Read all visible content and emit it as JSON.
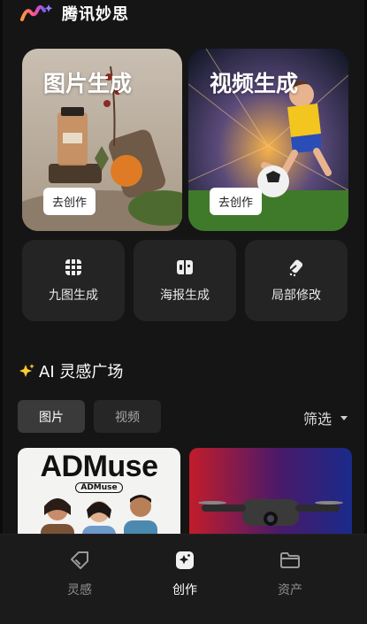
{
  "header": {
    "brand": "腾讯妙思",
    "logo_icon": "mio-brush-logo-icon"
  },
  "hero_cards": [
    {
      "title": "图片生成",
      "button": "去创作"
    },
    {
      "title": "视频生成",
      "button": "去创作"
    }
  ],
  "tools": [
    {
      "label": "九图生成",
      "icon": "grid-icon"
    },
    {
      "label": "海报生成",
      "icon": "poster-icon"
    },
    {
      "label": "局部修改",
      "icon": "eraser-icon"
    }
  ],
  "inspiration": {
    "title": "AI 灵感广场",
    "tabs": [
      "图片",
      "视频"
    ],
    "active_tab": "图片",
    "filter_label": "筛选"
  },
  "gallery": [
    {
      "headline": "ADMuse",
      "badge": "ADMuse"
    },
    {
      "subject": "drone"
    }
  ],
  "bottom_nav": [
    {
      "label": "灵感",
      "icon": "tag-icon",
      "active": false
    },
    {
      "label": "创作",
      "icon": "sparkle-square-icon",
      "active": true
    },
    {
      "label": "资产",
      "icon": "folder-icon",
      "active": false
    }
  ],
  "colors": {
    "background": "#151515",
    "card": "#242424",
    "tab_active": "#3a3a3a",
    "text_muted": "#a9a9a9"
  }
}
